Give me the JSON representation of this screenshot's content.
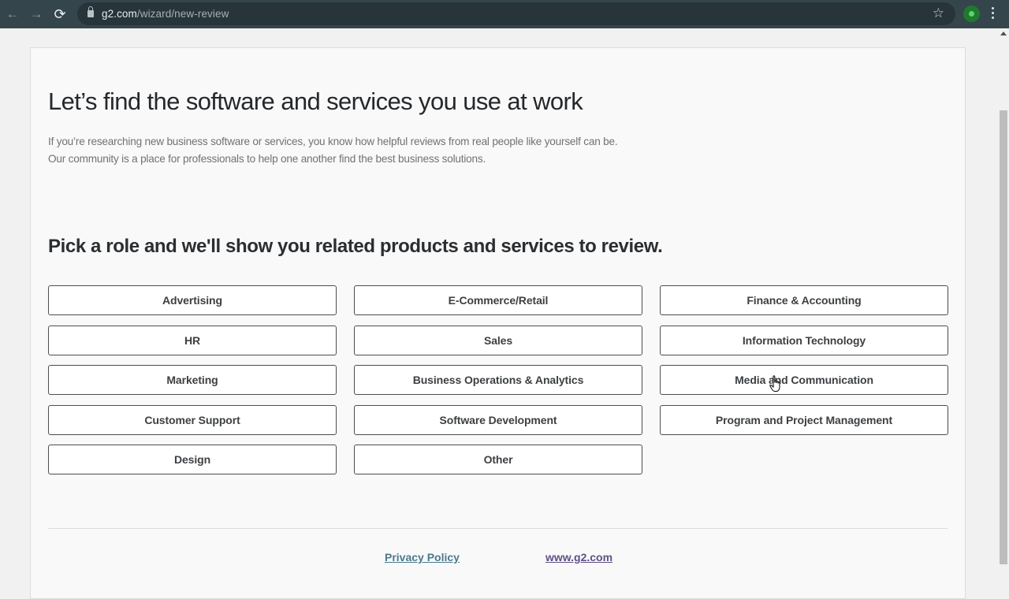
{
  "browser": {
    "url_host": "g2.com",
    "url_path": "/wizard/new-review",
    "back_icon": "←",
    "forward_icon": "→",
    "reload_icon": "⟳",
    "star_icon": "☆"
  },
  "page": {
    "title": "Let’s find the software and services you use at work",
    "description_line1": "If you’re researching new business software or services, you know how helpful reviews from real people like yourself can be.",
    "description_line2": "Our community is a place for professionals to help one another find the best business solutions.",
    "subtitle": "Pick a role and we'll show you related products and services to review.",
    "roles": [
      "Advertising",
      "E-Commerce/Retail",
      "Finance & Accounting",
      "HR",
      "Sales",
      "Information Technology",
      "Marketing",
      "Business Operations & Analytics",
      "Media and Communication",
      "Customer Support",
      "Software Development",
      "Program and Project Management",
      "Design",
      "Other"
    ]
  },
  "footer": {
    "privacy_label": "Privacy Policy",
    "site_label": "www.g2.com"
  }
}
